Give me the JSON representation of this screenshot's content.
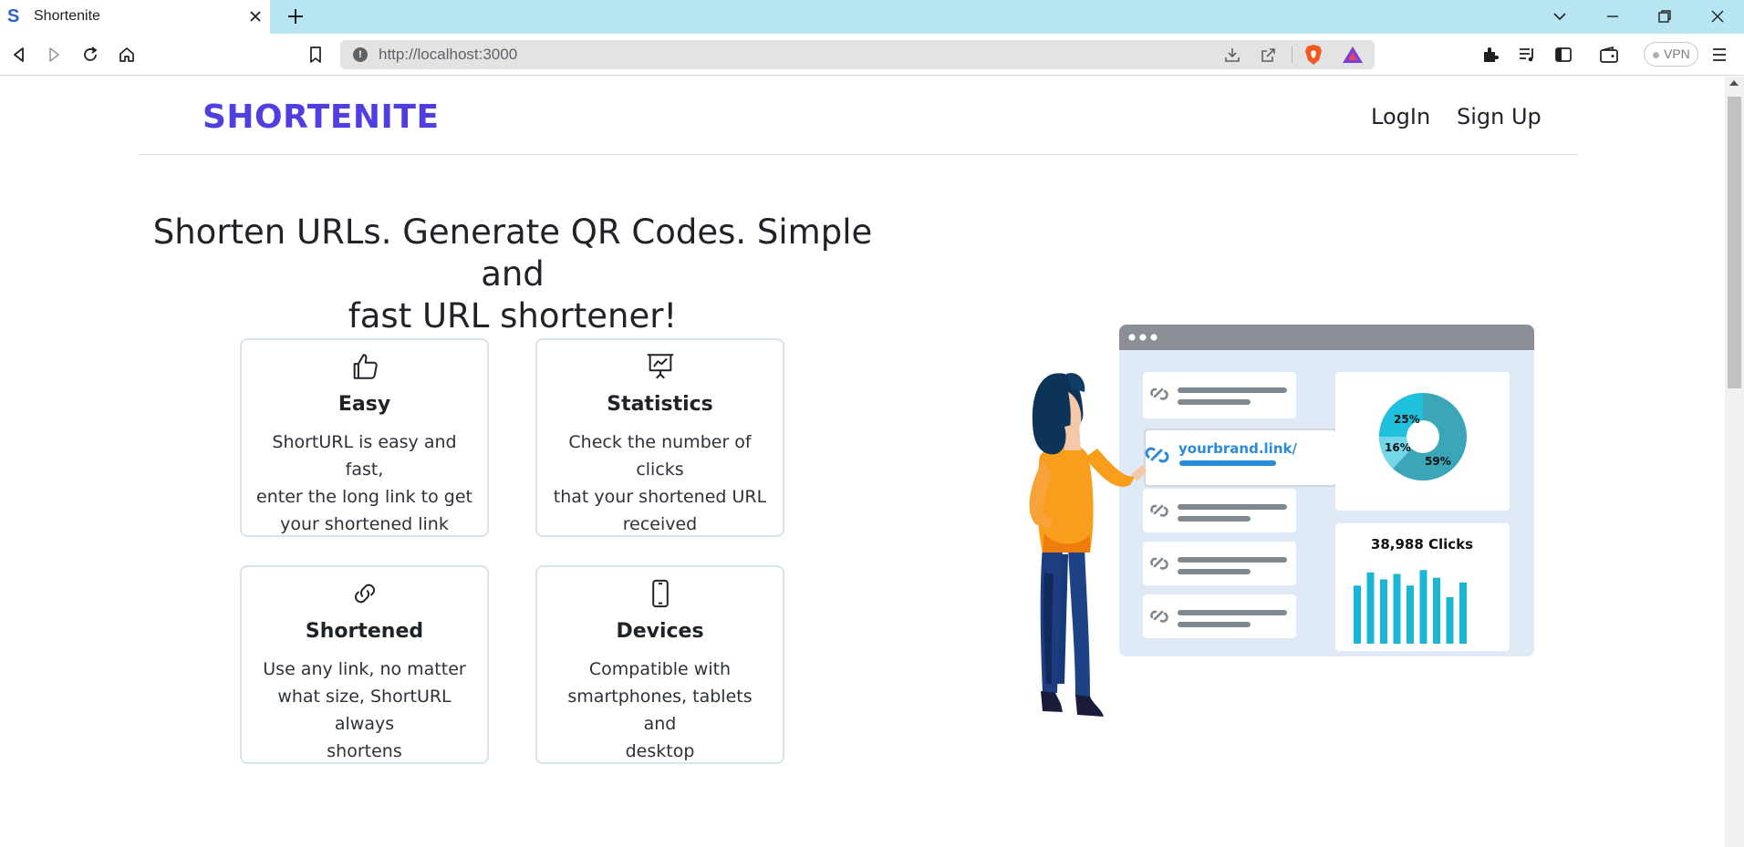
{
  "browser": {
    "tab_title": "Shortenite",
    "favicon_letter": "S",
    "url": "http://localhost:3000",
    "vpn_label": "VPN"
  },
  "nav": {
    "brand": "SHORTENITE",
    "login": "LogIn",
    "signup": "Sign Up"
  },
  "hero": {
    "title_line1": "Shorten URLs. Generate QR Codes. Simple and",
    "title_line2": "fast URL shortener!"
  },
  "features": [
    {
      "icon": "thumbs-up-icon",
      "title": "Easy",
      "desc_lines": [
        "ShortURL is easy and fast,",
        "enter the long link to get",
        "your shortened link"
      ]
    },
    {
      "icon": "presentation-chart-icon",
      "title": "Statistics",
      "desc_lines": [
        "Check the number of clicks",
        "that your shortened URL",
        "received"
      ]
    },
    {
      "icon": "link-icon",
      "title": "Shortened",
      "desc_lines": [
        "Use any link, no matter",
        "what size, ShortURL always",
        "shortens"
      ]
    },
    {
      "icon": "smartphone-icon",
      "title": "Devices",
      "desc_lines": [
        "Compatible with",
        "smartphones, tablets and",
        "desktop"
      ]
    }
  ],
  "illustration": {
    "link_text": "yourbrand.link/",
    "pie_labels": [
      "25%",
      "16%",
      "59%"
    ],
    "clicks_label": "38,988 Clicks",
    "bar_values": [
      0.75,
      0.92,
      0.83,
      0.9,
      0.75,
      0.95,
      0.85,
      0.6,
      0.79
    ]
  },
  "colors": {
    "brand": "#4f3fe0",
    "tabbar": "#b7e5f2",
    "card_border": "#d5e5ea"
  }
}
